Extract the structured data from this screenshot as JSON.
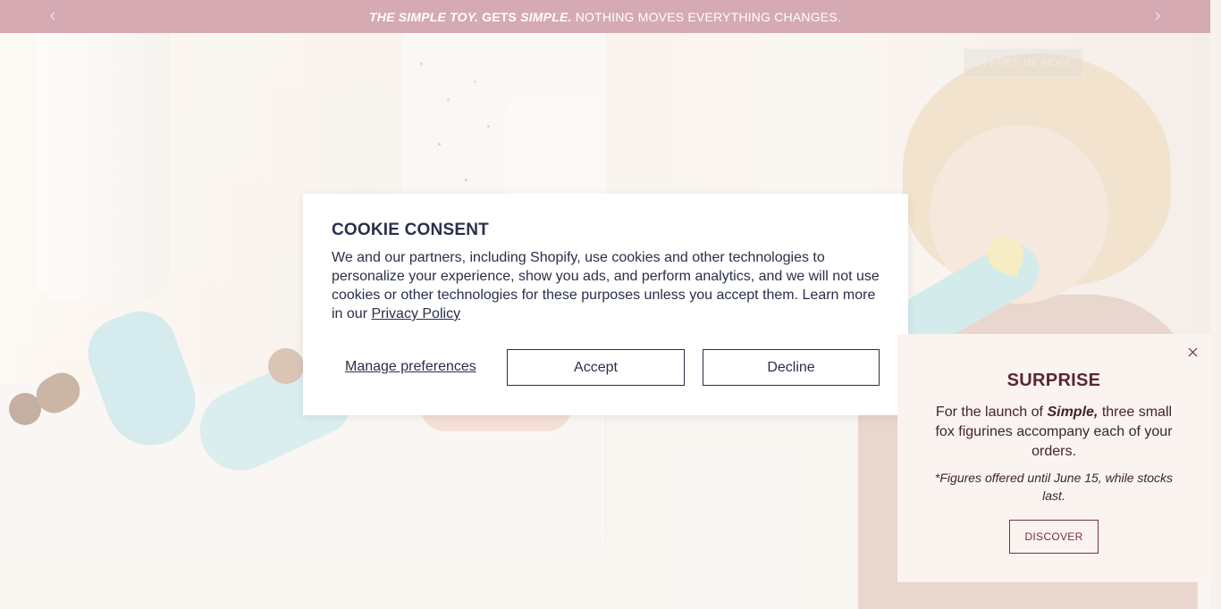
{
  "announcement": {
    "part1": "THE SIMPLE TOY.",
    "part2": "GETS",
    "part3": "SIMPLE.",
    "part4": "NOTHING MOVES EVERYTHING CHANGES.",
    "prev_icon": "chevron-left-icon",
    "next_icon": "chevron-right-icon"
  },
  "hero": {
    "offers_label": "OFFRES DE NOËL"
  },
  "cookie": {
    "title": "COOKIE CONSENT",
    "body": "We and our partners, including Shopify, use cookies and other technologies to personalize your experience, show you ads, and perform analytics, and we will not use cookies or other technologies for these purposes unless you accept them. Learn more in our",
    "privacy_link": "Privacy Policy",
    "manage_label": "Manage preferences",
    "accept_label": "Accept",
    "decline_label": "Decline"
  },
  "surprise": {
    "title": "SURPRISE",
    "body_before": "For the launch of",
    "body_brand": "Simple,",
    "body_after": "three small fox figurines accompany each of your orders.",
    "note": "*Figures offered until June 15, while stocks last.",
    "discover_label": "DISCOVER",
    "close_icon": "close-icon",
    "text_color": "#5a2638",
    "button_color": "#7a2e47"
  },
  "colors": {
    "announcement_bg": "#d6aab2",
    "cookie_text": "#2a2f4a",
    "popup_bg": "#fbf3ef"
  }
}
